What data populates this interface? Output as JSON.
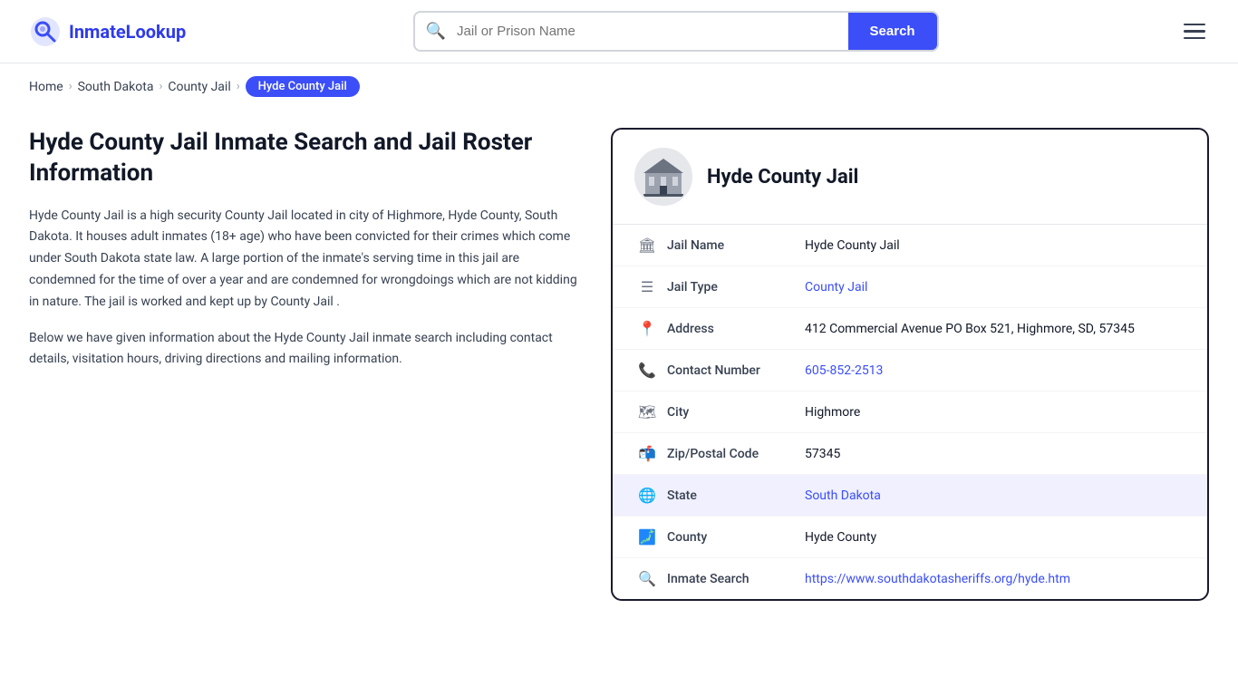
{
  "header": {
    "logo_text": "InmateLookup",
    "search_placeholder": "Jail or Prison Name",
    "search_button_label": "Search"
  },
  "breadcrumb": {
    "items": [
      {
        "label": "Home",
        "href": "#"
      },
      {
        "label": "South Dakota",
        "href": "#"
      },
      {
        "label": "County Jail",
        "href": "#"
      }
    ],
    "current": "Hyde County Jail"
  },
  "left": {
    "title": "Hyde County Jail Inmate Search and Jail Roster Information",
    "desc1": "Hyde County Jail is a high security County Jail located in city of Highmore, Hyde County, South Dakota. It houses adult inmates (18+ age) who have been convicted for their crimes which come under South Dakota state law. A large portion of the inmate's serving time in this jail are condemned for the time of over a year and are condemned for wrongdoings which are not kidding in nature. The jail is worked and kept up by County Jail .",
    "desc2": "Below we have given information about the Hyde County Jail inmate search including contact details, visitation hours, driving directions and mailing information."
  },
  "card": {
    "title": "Hyde County Jail",
    "rows": [
      {
        "icon": "building-icon",
        "label": "Jail Name",
        "value": "Hyde County Jail",
        "link": null,
        "highlighted": false
      },
      {
        "icon": "list-icon",
        "label": "Jail Type",
        "value": "County Jail",
        "link": "#",
        "highlighted": false
      },
      {
        "icon": "pin-icon",
        "label": "Address",
        "value": "412 Commercial Avenue PO Box 521, Highmore, SD, 57345",
        "link": null,
        "highlighted": false
      },
      {
        "icon": "phone-icon",
        "label": "Contact Number",
        "value": "605-852-2513",
        "link": "tel:6058522513",
        "highlighted": false
      },
      {
        "icon": "city-icon",
        "label": "City",
        "value": "Highmore",
        "link": null,
        "highlighted": false
      },
      {
        "icon": "zip-icon",
        "label": "Zip/Postal Code",
        "value": "57345",
        "link": null,
        "highlighted": false
      },
      {
        "icon": "globe-icon",
        "label": "State",
        "value": "South Dakota",
        "link": "#",
        "highlighted": true
      },
      {
        "icon": "county-icon",
        "label": "County",
        "value": "Hyde County",
        "link": null,
        "highlighted": false
      },
      {
        "icon": "search-globe-icon",
        "label": "Inmate Search",
        "value": "https://www.southdakotasheriffs.org/hyde.htm",
        "link": "https://www.southdakotasheriffs.org/hyde.htm",
        "highlighted": false
      }
    ]
  },
  "colors": {
    "primary": "#3b4ef8",
    "nav_dark": "#1a1a2e"
  }
}
